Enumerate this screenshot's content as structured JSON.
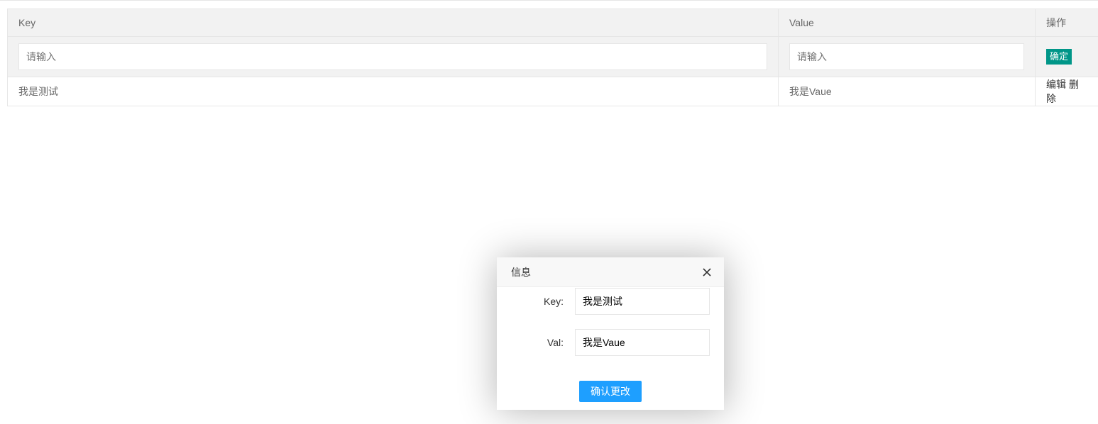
{
  "table": {
    "headers": {
      "key": "Key",
      "value": "Value",
      "op": "操作"
    },
    "input_row": {
      "key_placeholder": "请输入",
      "value_placeholder": "请输入",
      "confirm_label": "确定"
    },
    "rows": [
      {
        "key": "我是测试",
        "value": "我是Vaue",
        "edit_label": "编辑",
        "delete_label": "删除"
      }
    ]
  },
  "modal": {
    "title": "信息",
    "key_label": "Key:",
    "key_value": "我是测试",
    "val_label": "Val:",
    "val_value": "我是Vaue",
    "confirm_label": "确认更改"
  },
  "colors": {
    "confirm_green": "#009688",
    "confirm_blue": "#1e9fff",
    "header_bg": "#f2f2f2"
  }
}
